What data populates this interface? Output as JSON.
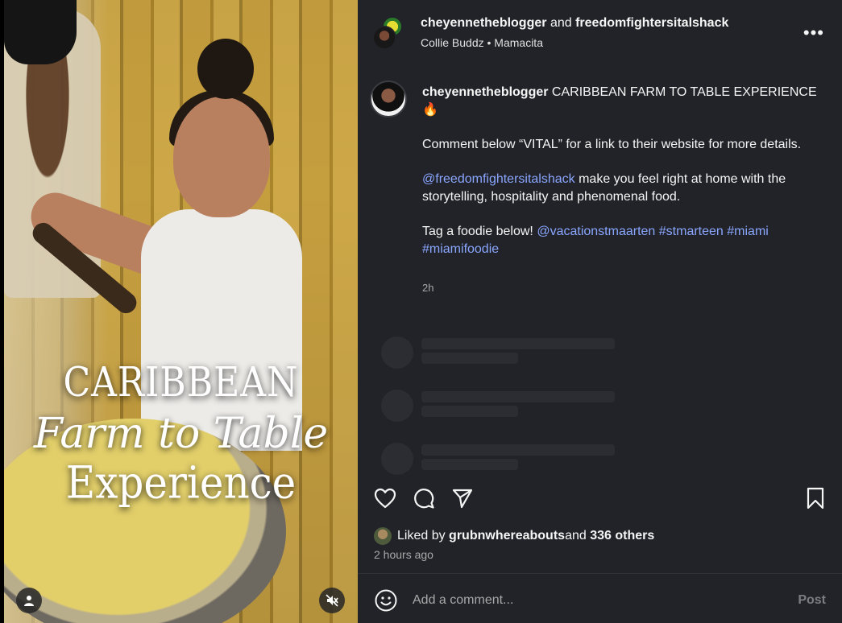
{
  "header": {
    "user1": "cheyennetheblogger",
    "joiner": "and",
    "user2": "freedomfightersitalshack",
    "audio_artist": "Collie Buddz",
    "separator": "•",
    "audio_track": "Mamacita",
    "more_icon": "more-options-icon"
  },
  "media": {
    "overlay_line1": "CARIBBEAN",
    "overlay_line2": "Farm to Table",
    "overlay_line3": "Experience",
    "user_icon": "user-tag-icon",
    "mute_icon": "mute-icon"
  },
  "caption": {
    "username": "cheyennetheblogger",
    "title": " CARIBBEAN FARM TO TABLE EXPERIENCE 🔥",
    "para1": "Comment below “VITAL” for a link to their website for more details.",
    "mention1": "@freedomfightersitalshack",
    "para2_rest": " make you feel right at home with the storytelling, hospitality and phenomenal food.",
    "para3_prefix": "Tag a foodie below! ",
    "mention2": "@vacationstmaarten",
    "tag1": "#stmarteen",
    "tag2": "#miami",
    "tag3": "#miamifoodie",
    "time": "2h"
  },
  "actions": {
    "like_icon": "heart-icon",
    "comment_icon": "comment-icon",
    "share_icon": "share-icon",
    "save_icon": "bookmark-icon"
  },
  "likes": {
    "prefix": "Liked by ",
    "user": "grubnwhereabouts",
    "middle": " and ",
    "others": "336 others",
    "time_ago": "2 hours ago"
  },
  "comment_bar": {
    "emoji_icon": "emoji-icon",
    "placeholder": "Add a comment...",
    "post_label": "Post"
  }
}
